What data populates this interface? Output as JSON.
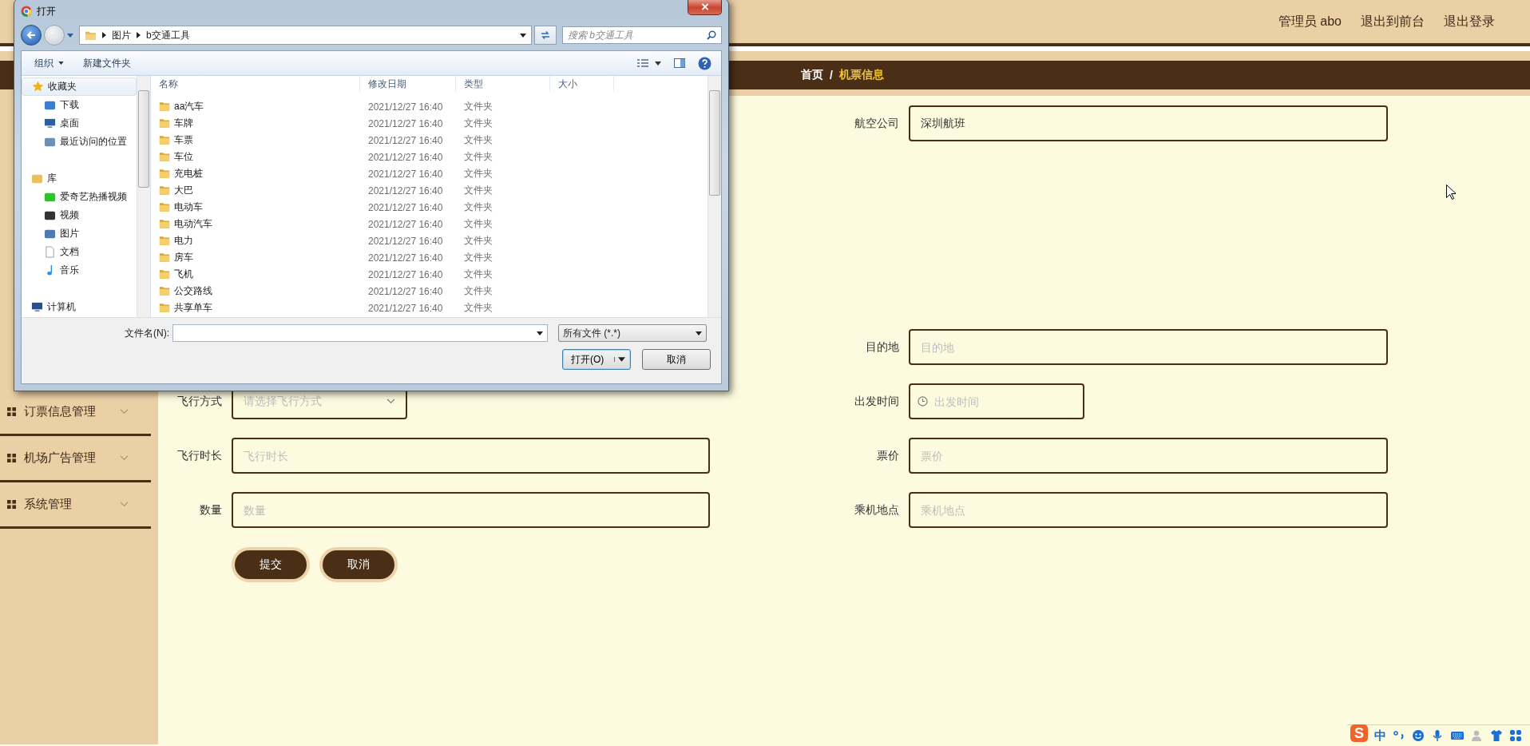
{
  "header": {
    "links": [
      "管理员 abo",
      "退出到前台",
      "退出登录"
    ]
  },
  "breadcrumb": {
    "separator": "/",
    "items": [
      {
        "label": "首页",
        "selected": false
      },
      {
        "label": "机票信息",
        "selected": true
      }
    ]
  },
  "sidebar": {
    "items": [
      {
        "label": "订票信息管理"
      },
      {
        "label": "机场广告管理"
      },
      {
        "label": "系统管理"
      }
    ]
  },
  "form": {
    "right_fields": [
      {
        "label": "航空公司",
        "kind": "text",
        "value": "深圳航班"
      },
      {
        "label": "目的地",
        "kind": "text",
        "placeholder": "目的地"
      },
      {
        "label": "出发时间",
        "kind": "datetime",
        "placeholder": "出发时间"
      },
      {
        "label": "票价",
        "kind": "text",
        "placeholder": "票价"
      },
      {
        "label": "乘机地点",
        "kind": "text",
        "placeholder": "乘机地点"
      }
    ],
    "left_fields": [
      {
        "label": "飞行方式",
        "kind": "select",
        "placeholder": "请选择飞行方式"
      },
      {
        "label": "飞行时长",
        "kind": "text",
        "placeholder": "飞行时长"
      },
      {
        "label": "数量",
        "kind": "text",
        "placeholder": "数量"
      }
    ],
    "buttons": [
      "提交",
      "取消"
    ]
  },
  "dialog": {
    "title": "打开",
    "path": [
      "图片",
      "b交通工具"
    ],
    "search": {
      "placeholder": "搜索 b交通工具"
    },
    "toolbar": [
      "组织",
      "新建文件夹"
    ],
    "nav": [
      {
        "label": "收藏夹",
        "kind": "favorites",
        "selected": true,
        "children": [
          {
            "label": "下载",
            "kind": "downloads",
            "selected": false
          },
          {
            "label": "桌面",
            "kind": "desktop",
            "selected": false
          },
          {
            "label": "最近访问的位置",
            "kind": "recent",
            "selected": false
          }
        ]
      },
      {
        "label": "库",
        "kind": "library",
        "selected": false,
        "children": [
          {
            "label": "爱奇艺热播视频",
            "kind": "app",
            "selected": false
          },
          {
            "label": "视频",
            "kind": "videos",
            "selected": false
          },
          {
            "label": "图片",
            "kind": "pictures",
            "selected": false
          },
          {
            "label": "文档",
            "kind": "documents",
            "selected": false
          },
          {
            "label": "音乐",
            "kind": "music",
            "selected": false
          }
        ]
      },
      {
        "label": "计算机",
        "kind": "computer",
        "selected": false
      }
    ],
    "columns": [
      "名称",
      "修改日期",
      "类型",
      "大小"
    ],
    "files": [
      {
        "name": "aa汽车",
        "modified": "2021/12/27 16:40",
        "type": "文件夹"
      },
      {
        "name": "车牌",
        "modified": "2021/12/27 16:40",
        "type": "文件夹"
      },
      {
        "name": "车票",
        "modified": "2021/12/27 16:40",
        "type": "文件夹"
      },
      {
        "name": "车位",
        "modified": "2021/12/27 16:40",
        "type": "文件夹"
      },
      {
        "name": "充电桩",
        "modified": "2021/12/27 16:40",
        "type": "文件夹"
      },
      {
        "name": "大巴",
        "modified": "2021/12/27 16:40",
        "type": "文件夹"
      },
      {
        "name": "电动车",
        "modified": "2021/12/27 16:40",
        "type": "文件夹"
      },
      {
        "name": "电动汽车",
        "modified": "2021/12/27 16:40",
        "type": "文件夹"
      },
      {
        "name": "电力",
        "modified": "2021/12/27 16:40",
        "type": "文件夹"
      },
      {
        "name": "房车",
        "modified": "2021/12/27 16:40",
        "type": "文件夹"
      },
      {
        "name": "飞机",
        "modified": "2021/12/27 16:40",
        "type": "文件夹"
      },
      {
        "name": "公交路线",
        "modified": "2021/12/27 16:40",
        "type": "文件夹"
      },
      {
        "name": "共享单车",
        "modified": "2021/12/27 16:40",
        "type": "文件夹"
      }
    ],
    "filename_label": "文件名(N):",
    "filter": "所有文件 (*.*)",
    "buttons": [
      "打开(O)",
      "取消"
    ]
  },
  "ime_bar": {
    "logo": "S",
    "mode": "中"
  }
}
